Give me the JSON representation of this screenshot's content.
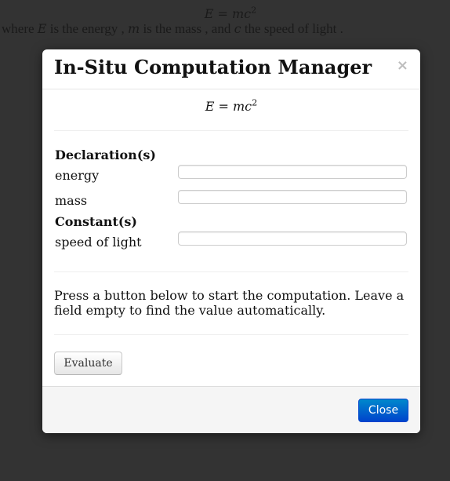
{
  "background": {
    "formula": {
      "lhs": "E",
      "equals": "=",
      "rhs_base": "mc",
      "rhs_exp": "2"
    },
    "sentence": {
      "where": "where",
      "var1": "E",
      "desc1": "is the energy ,",
      "var2": "m",
      "desc2": "is the mass , and",
      "var3": "c",
      "desc3": "the speed of light ."
    }
  },
  "modal": {
    "title": "In-Situ Computation Manager",
    "close_symbol": "×",
    "formula": {
      "lhs": "E",
      "equals": "=",
      "rhs_base": "mc",
      "rhs_exp": "2"
    },
    "declarations_heading": "Declaration(s)",
    "declarations": [
      {
        "label": "energy",
        "value": ""
      },
      {
        "label": "mass",
        "value": ""
      }
    ],
    "constants_heading": "Constant(s)",
    "constants": [
      {
        "label": "speed of light",
        "value": ""
      }
    ],
    "instructions": "Press a button below to start the computation. Leave a field empty to find the value automatically.",
    "evaluate_label": "Evaluate",
    "close_label": "Close"
  },
  "colors": {
    "overlay": "#333333",
    "primary_button": "#0066cc",
    "footer": "#f5f5f5"
  }
}
